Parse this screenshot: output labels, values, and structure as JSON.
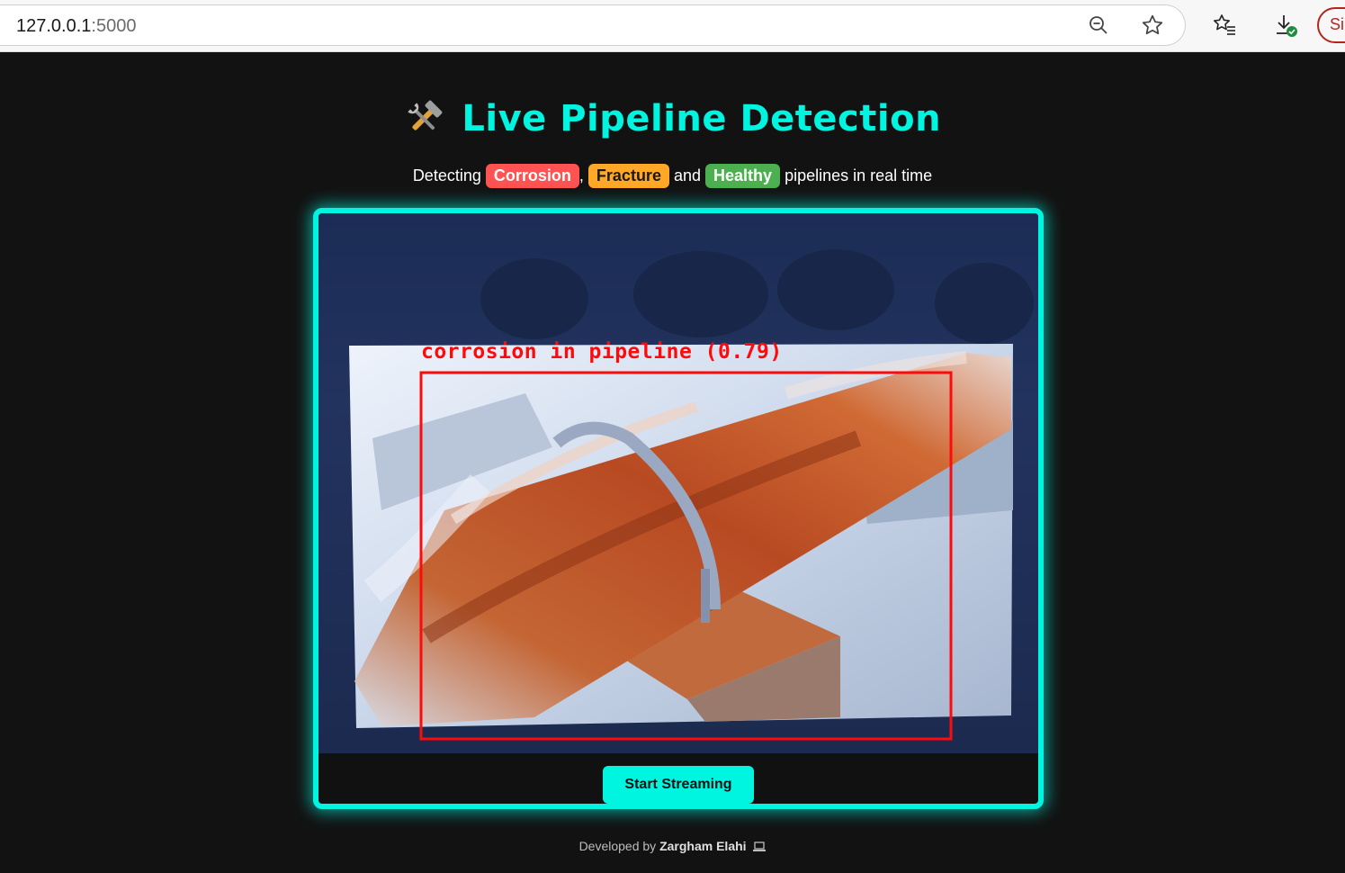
{
  "browser": {
    "url_host": "127.0.0.1",
    "url_port": ":5000",
    "signin_label": "Si"
  },
  "header": {
    "emoji": "🛠️",
    "title": "Live Pipeline Detection"
  },
  "subtitle": {
    "prefix": "Detecting",
    "corrosion": "Corrosion",
    "comma": ",",
    "fracture": "Fracture",
    "and": "and",
    "healthy": "Healthy",
    "suffix": "pipelines in real time"
  },
  "video": {
    "detection_label": "corrosion in pipeline (0.79)"
  },
  "controls": {
    "start_label": "Start Streaming"
  },
  "footer": {
    "prefix": "Developed by",
    "author": "Zargham Elahi",
    "icon": "laptop-icon"
  },
  "colors": {
    "accent": "#00f5e1",
    "corrosion": "#ff5252",
    "fracture": "#ffa726",
    "healthy": "#4caf50",
    "detection": "#ff0a0a"
  }
}
